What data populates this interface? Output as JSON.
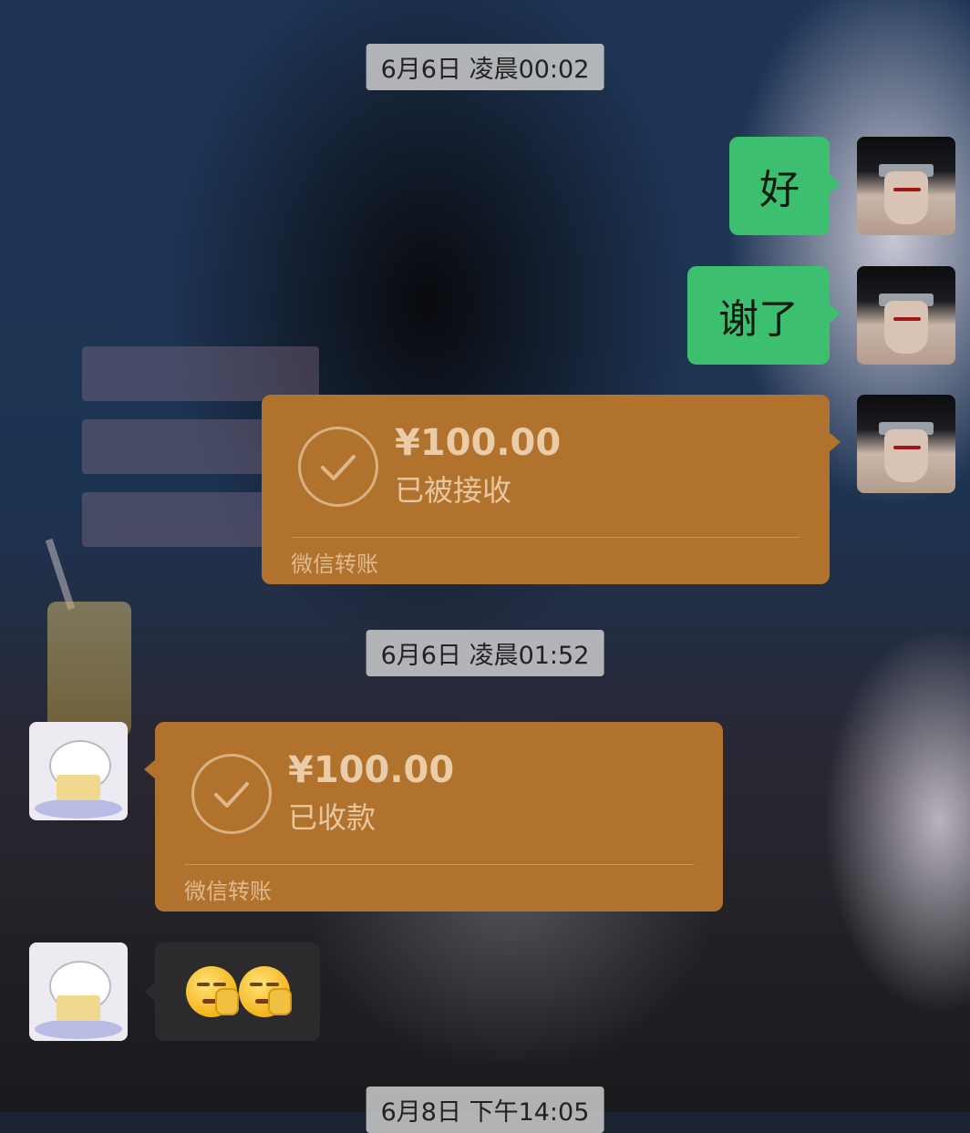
{
  "messages": {
    "ts1": "6月6日 凌晨00:02",
    "msg1": "好",
    "msg2": "谢了",
    "transfer1": {
      "amount": "¥100.00",
      "status": "已被接收",
      "footer": "微信转账"
    },
    "ts2": "6月6日 凌晨01:52",
    "transfer2": {
      "amount": "¥100.00",
      "status": "已收款",
      "footer": "微信转账"
    },
    "emoji_names": [
      "smirk-ok-emoji",
      "smirk-ok-emoji"
    ],
    "ts3": "6月8日 下午14:05"
  },
  "colors": {
    "green_bubble": "#3dbf70",
    "transfer_bubble": "#b0722d",
    "dark_bubble": "#2b2b2d",
    "timestamp_bg": "#cdcdcd"
  }
}
